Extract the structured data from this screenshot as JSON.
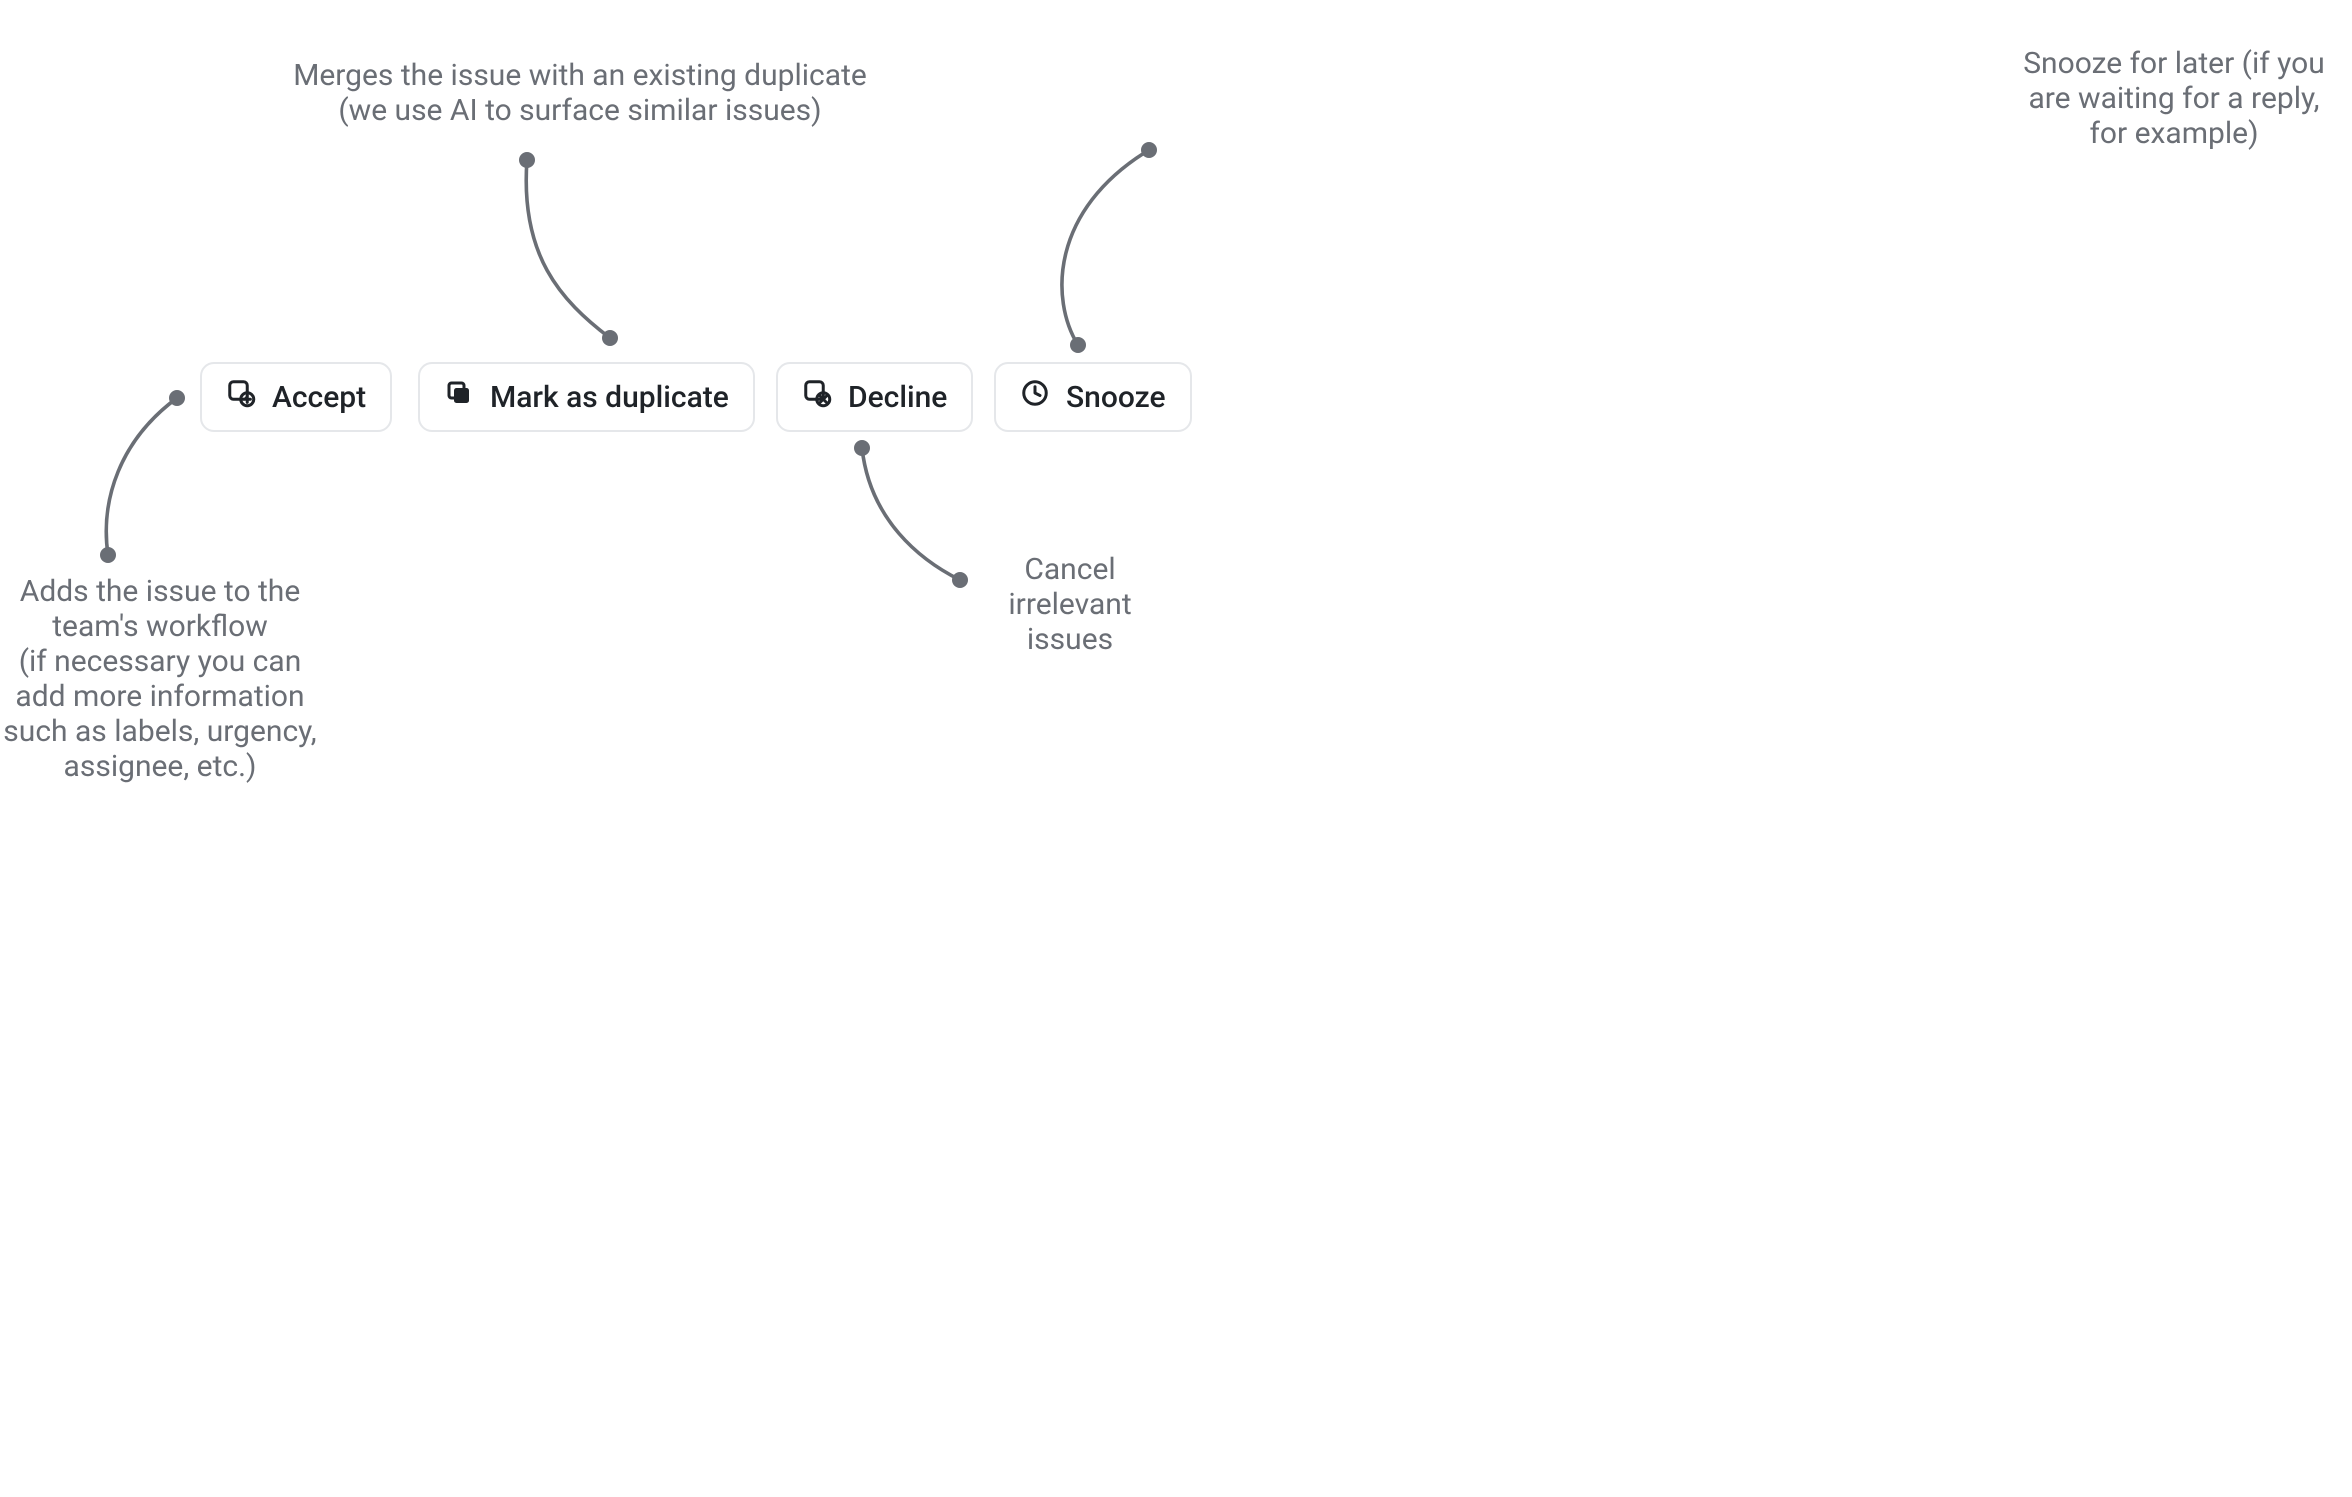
{
  "buttons": {
    "accept": {
      "label": "Accept"
    },
    "duplicate": {
      "label": "Mark as duplicate"
    },
    "decline": {
      "label": "Decline"
    },
    "snooze": {
      "label": "Snooze"
    }
  },
  "annotations": {
    "duplicate": "Merges the issue with an existing duplicate\n(we use AI to surface similar issues)",
    "snooze": "Snooze for later (if you\nare waiting for a reply,\nfor example)",
    "accept": "Adds the issue to the\nteam's workflow\n(if necessary you can\nadd more information\nsuch as labels, urgency,\nassignee, etc.)",
    "decline": "Cancel\nirrelevant\nissues"
  },
  "colors": {
    "annotation_text": "#6a6e75",
    "button_text": "#1f2328",
    "button_border": "#e5e7ea",
    "connector": "#6a6e75",
    "background": "#ffffff"
  }
}
